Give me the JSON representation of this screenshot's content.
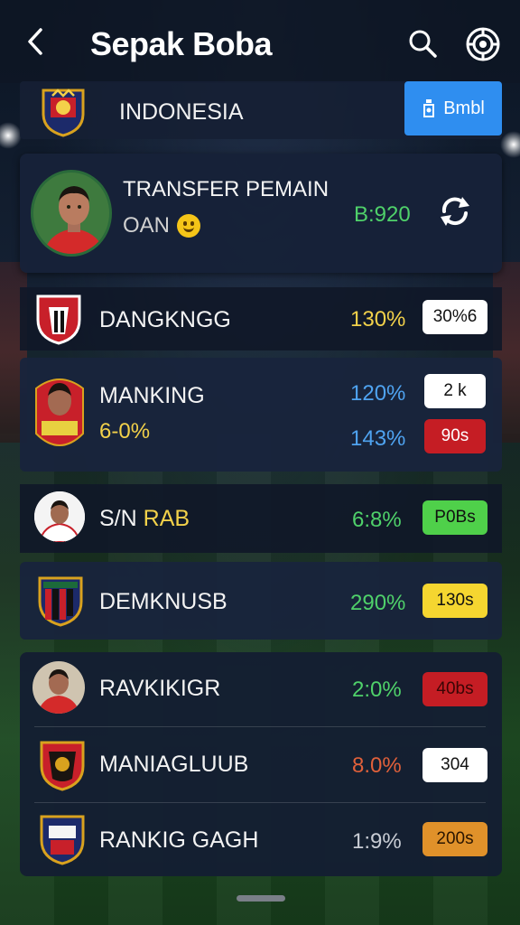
{
  "header": {
    "title": "Sepak Boba",
    "back_icon": "chevron-left-icon",
    "search_icon": "search-icon",
    "settings_icon": "gear-icon"
  },
  "country": {
    "name": "INDONESIA",
    "button_label": "Bmbl",
    "button_color": "#2f8ef0"
  },
  "transfer": {
    "title": "TRANSFER PEMAIN",
    "subtitle": "OAN",
    "value": "B:920",
    "value_color": "#4fd16a",
    "refresh_icon": "refresh-icon"
  },
  "rows": [
    {
      "name": "DANGKNGG",
      "pct": "130%",
      "pct_color": "#f2d14a",
      "badge": "30%6",
      "badge_bg": "#ffffff",
      "badge_fg": "#111111"
    },
    {
      "name": "MANKING",
      "sub": "6-0%",
      "sub_color": "#f2d14a",
      "pct": "120%",
      "pct_color": "#4fa3f0",
      "badge": "2 k",
      "badge_bg": "#ffffff",
      "badge_fg": "#111111",
      "pct2": "143%",
      "pct2_color": "#4fa3f0",
      "badge2": "90s",
      "badge2_bg": "#c51d24",
      "badge2_fg": "#ffffff"
    },
    {
      "name_a": "S/N",
      "name_b": "RAB",
      "name_b_color": "#f2d14a",
      "pct": "6:8%",
      "pct_color": "#4fd16a",
      "badge": "P0Bs",
      "badge_bg": "#4fd04a",
      "badge_fg": "#111111"
    },
    {
      "name": "DEMKNUSB",
      "pct": "290%",
      "pct_color": "#4fd16a",
      "badge": "130s",
      "badge_bg": "#f5d630",
      "badge_fg": "#111111"
    },
    {
      "name": "RAVKIKIGR",
      "pct": "2:0%",
      "pct_color": "#4fd16a",
      "badge": "40bs",
      "badge_bg": "#c51d24",
      "badge_fg": "#3a0505"
    },
    {
      "name": "MANIAGLUUB",
      "pct": "8.0%",
      "pct_color": "#e0603a",
      "badge": "304",
      "badge_bg": "#ffffff",
      "badge_fg": "#111111"
    },
    {
      "name": "RANKIG GAGH",
      "pct": "1:9%",
      "pct_color": "#c8ccd4",
      "badge": "200s",
      "badge_bg": "#e0912a",
      "badge_fg": "#2a1500"
    }
  ]
}
